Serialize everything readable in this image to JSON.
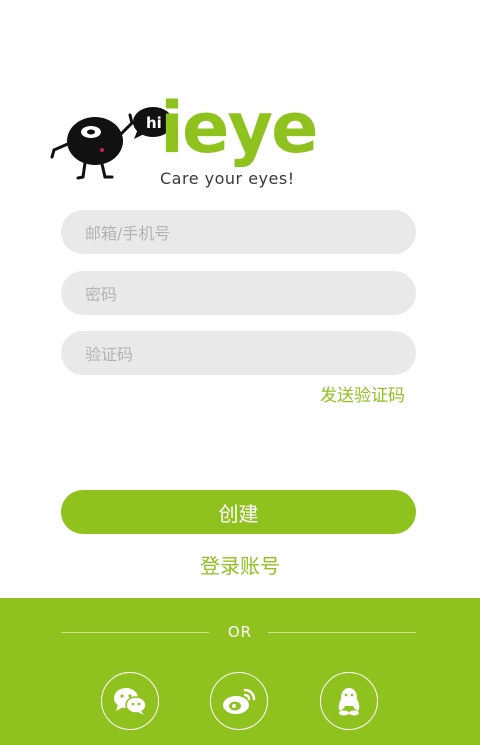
{
  "brand": {
    "bubble_text": "hi",
    "wordmark": "ieye",
    "tagline": "Care your eyes!"
  },
  "form": {
    "account_placeholder": "邮箱/手机号",
    "password_placeholder": "密码",
    "code_placeholder": "验证码",
    "send_code_label": "发送验证码",
    "create_label": "创建",
    "login_label": "登录账号"
  },
  "social": {
    "or_label": "OR",
    "items": [
      {
        "name": "wechat",
        "icon": "wechat-icon"
      },
      {
        "name": "weibo",
        "icon": "weibo-icon"
      },
      {
        "name": "qq",
        "icon": "qq-icon"
      }
    ]
  },
  "colors": {
    "accent": "#8fc21f",
    "input_bg": "#e9e9e9",
    "placeholder": "#b3b3b3"
  }
}
